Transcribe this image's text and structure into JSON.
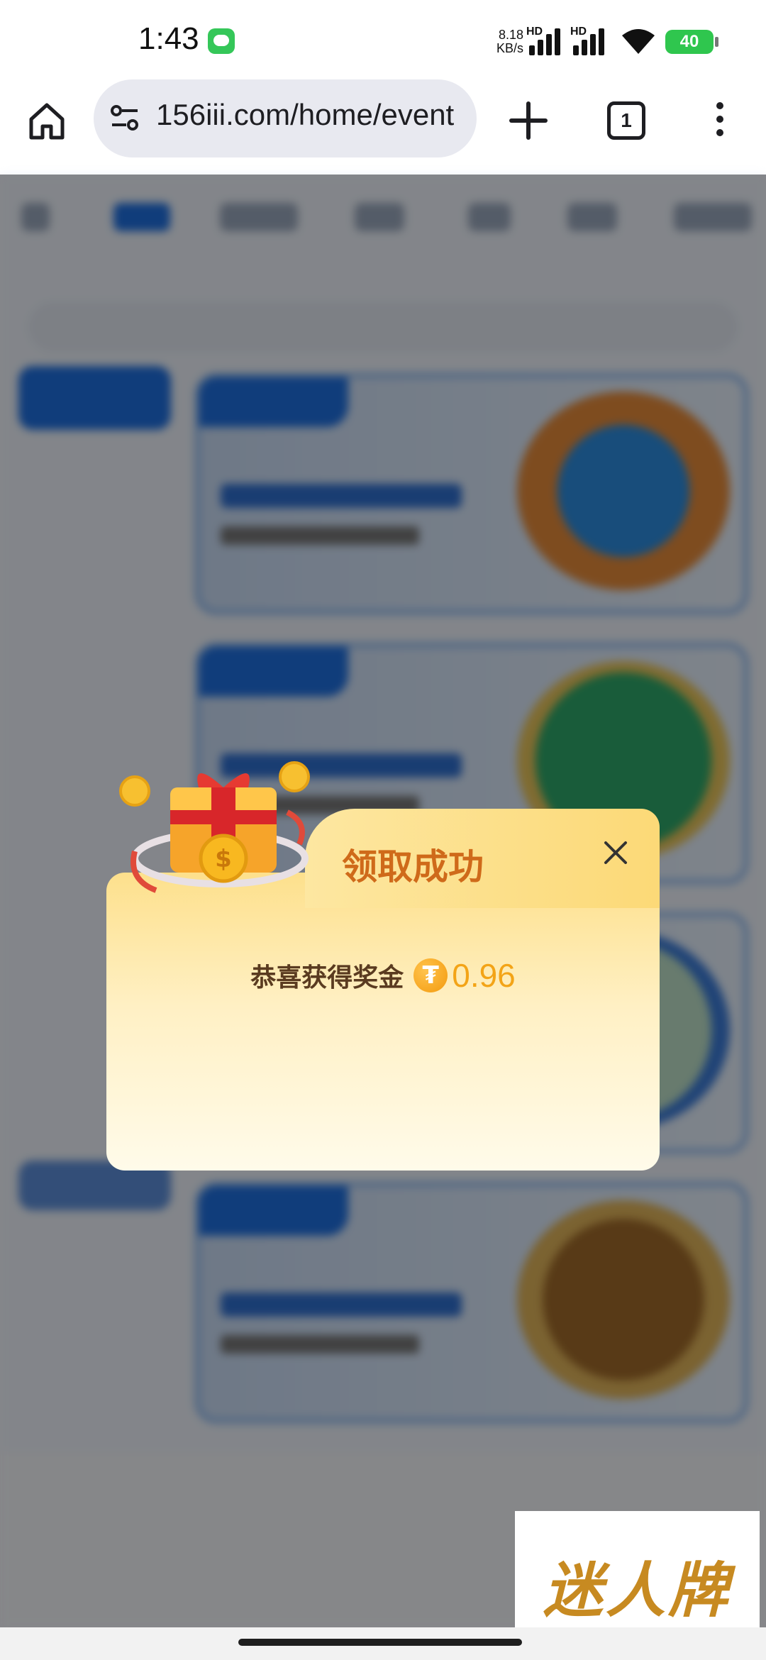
{
  "status_bar": {
    "time": "1:43",
    "net_speed_value": "8.18",
    "net_speed_unit": "KB/s",
    "sim1_label": "HD",
    "sim2_label": "HD",
    "battery": "40"
  },
  "browser": {
    "url": "156iii.com/home/event",
    "tab_count": "1"
  },
  "modal": {
    "title": "领取成功",
    "reward_label": "恭喜获得奖金",
    "coin_symbol": "₮",
    "reward_amount": "0.96"
  },
  "watermark": {
    "text": "迷人牌"
  },
  "colors": {
    "accent": "#1e6fe0",
    "modal_title": "#cf6a1a",
    "reward_amount": "#f3a417"
  }
}
